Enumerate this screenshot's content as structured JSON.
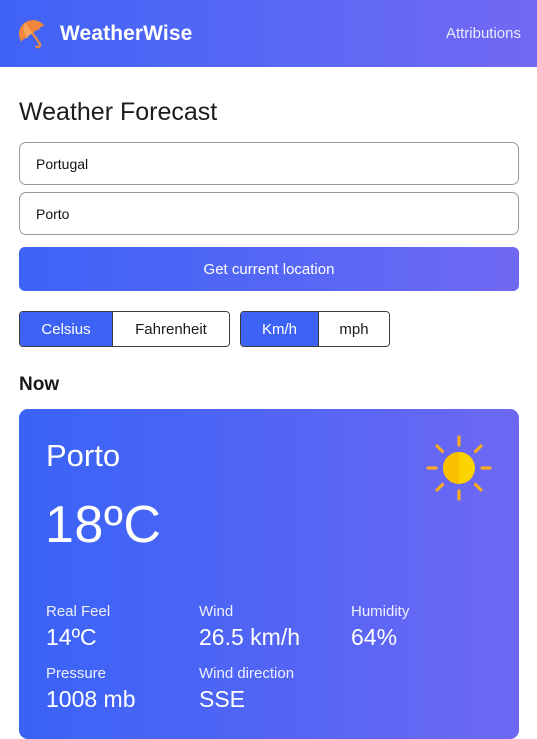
{
  "header": {
    "brand_name": "WeatherWise",
    "brand_icon": "umbrella-icon",
    "attributions_label": "Attributions"
  },
  "page": {
    "title": "Weather Forecast"
  },
  "form": {
    "country_value": "Portugal",
    "city_value": "Porto",
    "location_button_label": "Get current location"
  },
  "units": {
    "temperature": {
      "options": [
        "Celsius",
        "Fahrenheit"
      ],
      "selected": "Celsius"
    },
    "speed": {
      "options": [
        "Km/h",
        "mph"
      ],
      "selected": "Km/h"
    }
  },
  "now": {
    "section_title": "Now",
    "city": "Porto",
    "temperature": "18ºC",
    "condition_icon": "sun-icon",
    "metrics": {
      "real_feel": {
        "label": "Real Feel",
        "value": "14ºC"
      },
      "wind": {
        "label": "Wind",
        "value": "26.5 km/h"
      },
      "humidity": {
        "label": "Humidity",
        "value": "64%"
      },
      "pressure": {
        "label": "Pressure",
        "value": "1008 mb"
      },
      "wind_direction": {
        "label": "Wind direction",
        "value": "SSE"
      }
    }
  },
  "colors": {
    "accent": "#3d63f6",
    "gradient_end": "#7268f3",
    "sun": "#fdd300",
    "sun_rays": "#f9a825",
    "umbrella": "#f0873a"
  }
}
